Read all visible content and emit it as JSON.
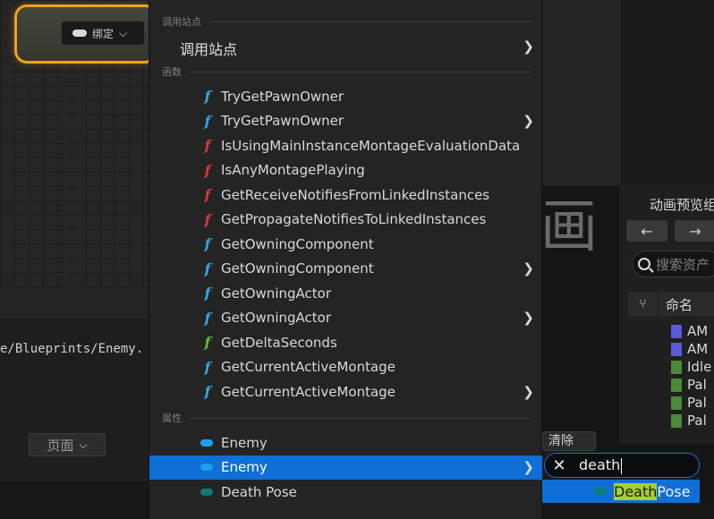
{
  "colors": {
    "function_blue": "#2fa8e6",
    "function_red": "#d83a3a",
    "function_green": "#5cc030",
    "var_blue": "#1e9fe8",
    "var_teal": "#0e7a72",
    "selection": "#0f6fd6",
    "node_border": "#f0a11e",
    "highlight": "#a8d030"
  },
  "graph": {
    "bind_button_label": "绑定",
    "path_text": "e/Blueprints/Enemy.",
    "page_button_label": "页面"
  },
  "menu": {
    "section_call_site": "调用站点",
    "call_site_item": "调用站点",
    "section_functions": "函数",
    "functions": [
      {
        "label": "TryGetPawnOwner",
        "color": "#2fa8e6",
        "submenu": false
      },
      {
        "label": "TryGetPawnOwner",
        "color": "#2fa8e6",
        "submenu": true
      },
      {
        "label": "IsUsingMainInstanceMontageEvaluationData",
        "color": "#d83a3a",
        "submenu": false
      },
      {
        "label": "IsAnyMontagePlaying",
        "color": "#d83a3a",
        "submenu": false
      },
      {
        "label": "GetReceiveNotifiesFromLinkedInstances",
        "color": "#d83a3a",
        "submenu": false
      },
      {
        "label": "GetPropagateNotifiesToLinkedInstances",
        "color": "#d83a3a",
        "submenu": false
      },
      {
        "label": "GetOwningComponent",
        "color": "#2fa8e6",
        "submenu": false
      },
      {
        "label": "GetOwningComponent",
        "color": "#2fa8e6",
        "submenu": true
      },
      {
        "label": "GetOwningActor",
        "color": "#2fa8e6",
        "submenu": false
      },
      {
        "label": "GetOwningActor",
        "color": "#2fa8e6",
        "submenu": true
      },
      {
        "label": "GetDeltaSeconds",
        "color": "#5cc030",
        "submenu": false
      },
      {
        "label": "GetCurrentActiveMontage",
        "color": "#2fa8e6",
        "submenu": false
      },
      {
        "label": "GetCurrentActiveMontage",
        "color": "#2fa8e6",
        "submenu": true
      }
    ],
    "section_properties": "属性",
    "properties": [
      {
        "label": "Enemy",
        "color": "#1e9fe8",
        "submenu": false,
        "selected": false
      },
      {
        "label": "Enemy",
        "color": "#1e9fe8",
        "submenu": true,
        "selected": true
      },
      {
        "label": "Death Pose",
        "color": "#0e7a72",
        "submenu": false,
        "selected": false
      }
    ]
  },
  "search": {
    "query": "death",
    "result_match": "Death",
    "result_rest": "Pose"
  },
  "anim_panel": {
    "title": "动画预览组",
    "search_placeholder": "搜索资产",
    "name_column": "命名",
    "rows": [
      {
        "name": "AM",
        "color": "#5a5ad8"
      },
      {
        "name": "AM",
        "color": "#5a5ad8"
      },
      {
        "name": "Idle",
        "color": "#4c8a3a"
      },
      {
        "name": "Pal",
        "color": "#4c8a3a"
      },
      {
        "name": "Pal",
        "color": "#4c8a3a"
      },
      {
        "name": "Pal",
        "color": "#4c8a3a"
      }
    ]
  },
  "misc": {
    "clear_label": "清除",
    "big_glyph": "画"
  }
}
